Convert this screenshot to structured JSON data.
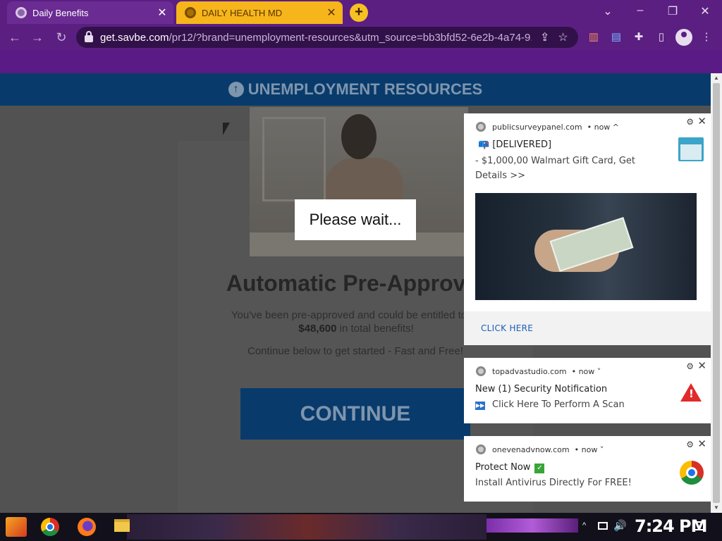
{
  "browser": {
    "tabs": [
      {
        "title": "Daily Benefits",
        "active": true
      },
      {
        "title": "DAILY HEALTH MD",
        "active": false
      }
    ],
    "new_tab_label": "+",
    "window_controls": {
      "minimize": "–",
      "restore": "❐",
      "close": "✕",
      "tab_search": "⌄"
    },
    "nav": {
      "back": "←",
      "forward": "→",
      "reload": "↻"
    },
    "url": {
      "host": "get.savbe.com",
      "path": "/pr12/?brand=unemployment-resources&utm_source=bb3bfd52-6e2b-4a74-9..."
    },
    "omnibox_icons": {
      "share": "⇪",
      "bookmark": "☆"
    }
  },
  "page": {
    "header_icon": "↑",
    "header_title": "UNEMPLOYMENT RESOURCES",
    "headline": "Automatic Pre-Approval",
    "subtext_line1": "You've been pre-approved and could be entitled to as",
    "amount": "$48,600",
    "subtext_line2_suffix": " in total benefits!",
    "subtext2": "Continue below to get started - Fast and Free!",
    "continue_label": "CONTINUE",
    "overlay": "Please wait..."
  },
  "notifications": [
    {
      "source": "publicsurveypanel.com",
      "time": "• now ^",
      "line1": "📪 [DELIVERED]",
      "line2": " - $1,000,00 Walmart Gift Card, Get Details >>",
      "action": "CLICK HERE"
    },
    {
      "source": "topadvastudio.com",
      "time": "• now ˅",
      "line1": "New (1) Security Notification",
      "line2": "Click Here To Perform A Scan",
      "play_icon": "▶▶",
      "warn_icon": "!"
    },
    {
      "source": "onevenadvnow.com",
      "time": "• now ˅",
      "line1": "Protect Now",
      "check_icon": "✓",
      "line2": "Install Antivirus Directly For FREE!"
    }
  ],
  "notif_controls": {
    "gear": "⚙",
    "close": "✕"
  },
  "taskbar": {
    "clock": "7:24 PM",
    "tray_up": "^",
    "volume": "🔊"
  }
}
